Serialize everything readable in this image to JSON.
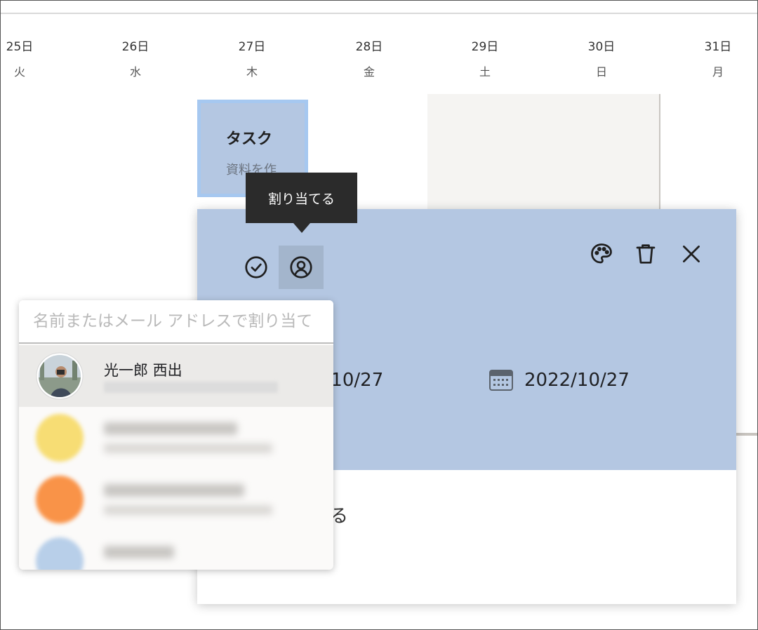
{
  "calendar": {
    "days": [
      {
        "date": "25日",
        "weekday": "火"
      },
      {
        "date": "26日",
        "weekday": "水"
      },
      {
        "date": "27日",
        "weekday": "木"
      },
      {
        "date": "28日",
        "weekday": "金"
      },
      {
        "date": "29日",
        "weekday": "土"
      },
      {
        "date": "30日",
        "weekday": "日"
      },
      {
        "date": "31日",
        "weekday": "月"
      }
    ]
  },
  "task_card": {
    "title": "タスク",
    "subtitle": "資料を作"
  },
  "tooltip": {
    "text": "割り当てる"
  },
  "panel": {
    "start_date_partial": "2/10/27",
    "end_date": "2022/10/27",
    "trailing_text_partial": "る",
    "icons": [
      "check-circle-icon",
      "assign-user-icon",
      "palette-icon",
      "trash-icon",
      "close-icon"
    ],
    "color": "#b4c7e2"
  },
  "assign_dropdown": {
    "search_placeholder": "名前またはメール アドレスで割り当て",
    "people": [
      {
        "name": "光一郎 西出",
        "avatar_color": "#6f8ba0"
      },
      {
        "name": "",
        "avatar_color": "#f7dd74"
      },
      {
        "name": "",
        "avatar_color": "#f99348"
      },
      {
        "name": "",
        "avatar_color": "#b8cfe9"
      }
    ]
  }
}
